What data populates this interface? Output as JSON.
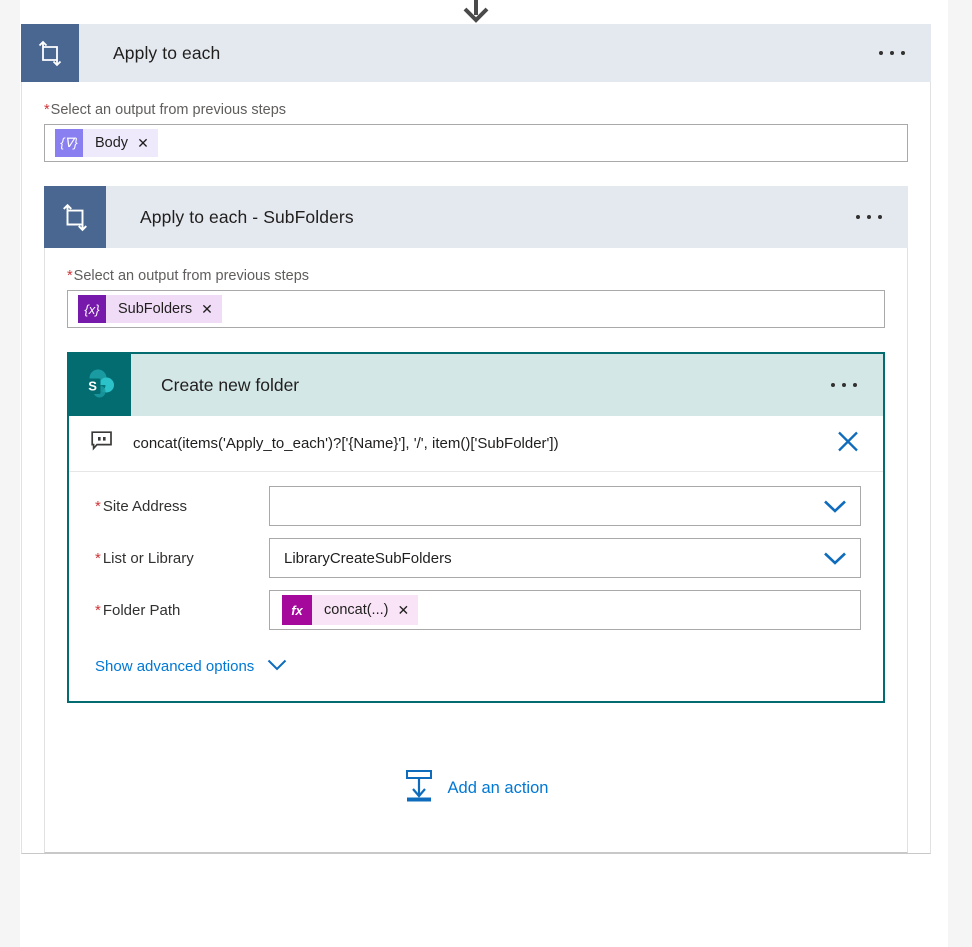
{
  "canvas": {
    "background": "#ffffff",
    "gutter_color": "#f5f5f5"
  },
  "connector": {
    "top_arrow_icon": "arrow-down-icon",
    "color": "#4a4a4a"
  },
  "outer_loop": {
    "title": "Apply to each",
    "icon": "loop-repeat-icon",
    "header_bg": "#e4e8ef",
    "icon_bg": "#4a6792",
    "overflow_menu": "...",
    "input_label": "Select an output from previous steps",
    "required_marker": "*",
    "token": {
      "icon_glyph": "{∇}",
      "icon_name": "dynamic-content-body-icon",
      "label": "Body",
      "remove": "✕",
      "icon_color": "#8a7ff0",
      "label_bg": "#eeeafc"
    }
  },
  "inner_loop": {
    "title": "Apply to each - SubFolders",
    "icon": "loop-repeat-icon",
    "header_bg": "#e4e8ef",
    "icon_bg": "#4a6792",
    "overflow_menu": "...",
    "input_label": "Select an output from previous steps",
    "required_marker": "*",
    "token": {
      "icon_glyph": "{x}",
      "icon_name": "dynamic-content-subfolders-icon",
      "label": "SubFolders",
      "remove": "✕",
      "icon_color": "#7719aa",
      "label_bg": "#f0dcf7"
    }
  },
  "action_card": {
    "title": "Create new folder",
    "icon": "sharepoint-icon",
    "header_bg": "#d4e7e7",
    "icon_bg": "#036c70",
    "border_color": "#036c70",
    "overflow_menu": "...",
    "expression": {
      "icon": "comment-bubble-icon",
      "text": "concat(items('Apply_to_each')?['{Name}'], '/', item()['SubFolder'])",
      "close": "✕",
      "close_color": "#0078d4"
    },
    "fields": [
      {
        "label": "Site Address",
        "required": "*",
        "type": "combobox",
        "value": "",
        "placeholder": "",
        "chevron": "chevron-down-icon"
      },
      {
        "label": "List or Library",
        "required": "*",
        "type": "combobox",
        "value": "LibraryCreateSubFolders",
        "placeholder": "",
        "chevron": "chevron-down-icon"
      }
    ],
    "folder_path": {
      "label": "Folder Path",
      "required": "*",
      "token": {
        "icon_glyph": "fx",
        "icon_name": "expression-fx-icon",
        "label": "concat(...)",
        "remove": "✕",
        "icon_color": "#a4099b",
        "label_bg": "#f9e4f7"
      }
    },
    "advanced": {
      "label": "Show advanced options",
      "chevron": "chevron-down-icon",
      "color": "#0078d4"
    }
  },
  "add_action": {
    "label": "Add an action",
    "icon": "insert-action-icon",
    "color": "#0078d4"
  }
}
